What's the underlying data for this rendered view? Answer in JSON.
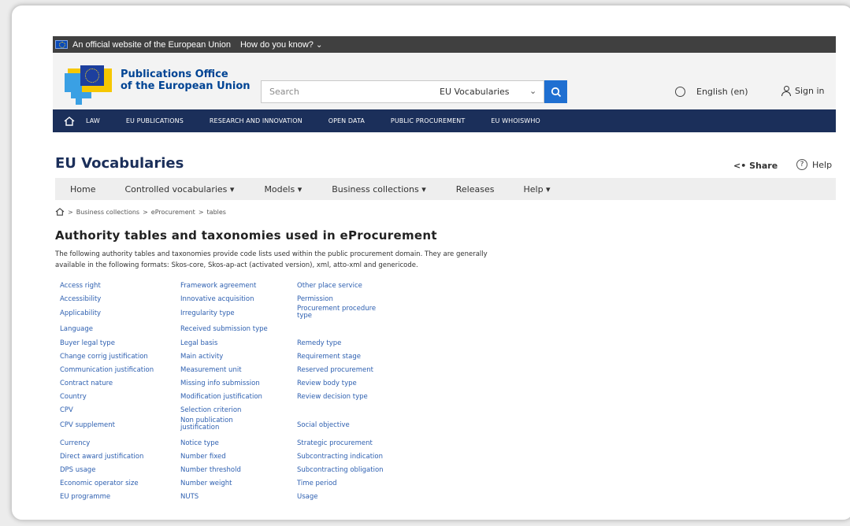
{
  "eu_bar": {
    "official": "An official website of the European Union",
    "how_know": "How do you know?"
  },
  "header": {
    "logo_line1": "Publications Office",
    "logo_line2": "of the European Union",
    "search_placeholder": "Search",
    "scope": "EU Vocabularies",
    "language": "English (en)",
    "sign_in": "Sign in"
  },
  "nav": {
    "items": [
      "LAW",
      "EU PUBLICATIONS",
      "RESEARCH AND INNOVATION",
      "OPEN DATA",
      "PUBLIC PROCUREMENT",
      "EU WHOISWHO"
    ]
  },
  "site": {
    "title": "EU Vocabularies",
    "share": "Share",
    "help": "Help"
  },
  "menu": {
    "items": [
      "Home",
      "Controlled vocabularies ▾",
      "Models ▾",
      "Business collections ▾",
      "Releases",
      "Help ▾"
    ]
  },
  "breadcrumb": {
    "items": [
      "Business collections",
      "eProcurement",
      "tables"
    ]
  },
  "main": {
    "title": "Authority tables and taxonomies used in eProcurement",
    "intro_line1": "The following authority tables and taxonomies provide code lists used within the public procurement domain. They are generally",
    "intro_line2": "available in the following formats: Skos-core, Skos-ap-act (activated version), xml, atto-xml and genericode."
  },
  "tables": {
    "col1": [
      "Access right",
      "Accessibility",
      "Applicability",
      "Language",
      "Buyer legal type",
      "Change corrig justification",
      "Communication justification",
      "Contract nature",
      "Country",
      "CPV",
      "CPV supplement",
      "Currency",
      "Direct award justification",
      "DPS usage",
      "Economic operator size",
      "EU programme"
    ],
    "col2": [
      "Framework agreement",
      "Innovative acquisition",
      "Irregularity type",
      "Received submission type",
      "Legal basis",
      "Main activity",
      "Measurement unit",
      "Missing info submission",
      "Modification justification",
      "Selection criterion",
      "Non publication justification",
      "Notice type",
      "Number fixed",
      "Number threshold",
      "Number weight",
      "NUTS"
    ],
    "col3": [
      "Other place service",
      "Permission",
      "Procurement procedure type",
      "",
      "Remedy type",
      "Requirement stage",
      "Reserved procurement",
      "Review body type",
      "Review decision type",
      "",
      "Social objective",
      "Strategic procurement",
      "Subcontracting indication",
      "Subcontracting obligation",
      "Time period",
      "Usage"
    ]
  }
}
